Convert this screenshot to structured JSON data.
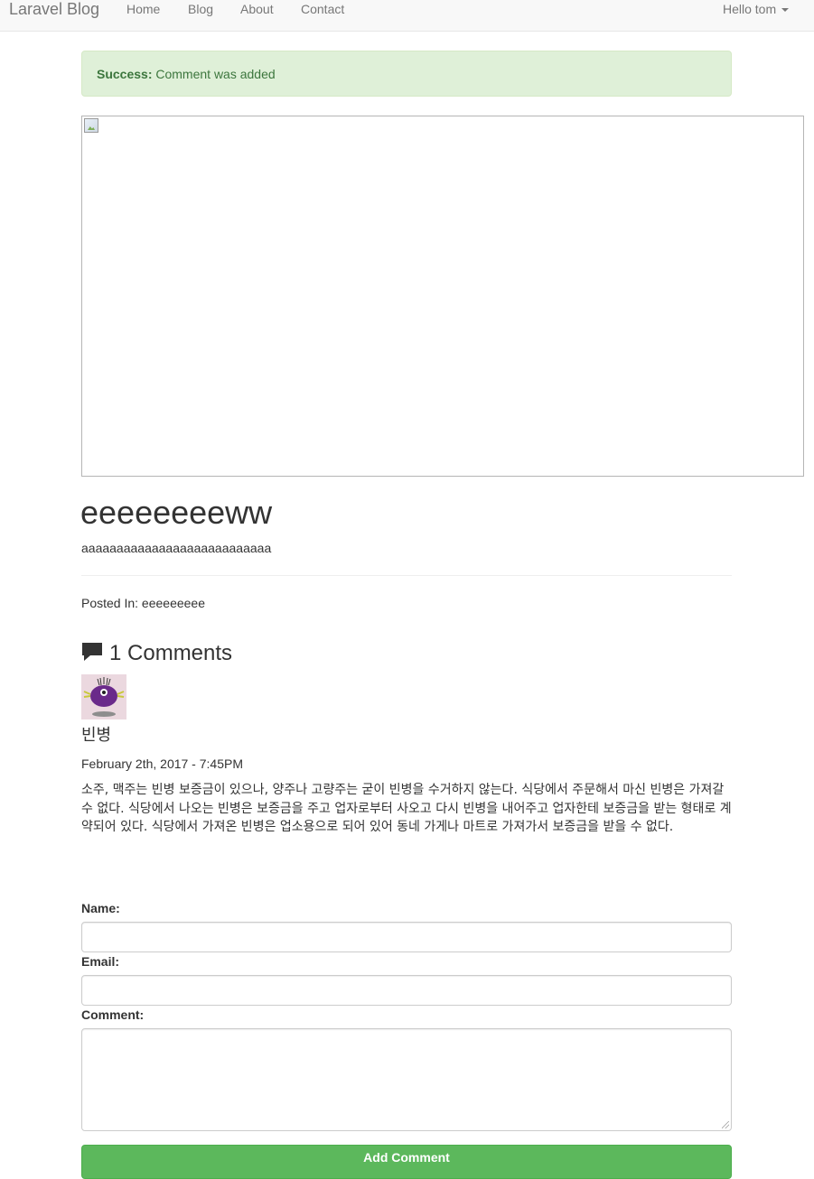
{
  "navbar": {
    "brand": "Laravel Blog",
    "links": [
      "Home",
      "Blog",
      "About",
      "Contact"
    ],
    "user_menu": "Hello tom"
  },
  "alert": {
    "title": "Success:",
    "message": "Comment was added",
    "color_bg": "#dff0d8",
    "color_text": "#3c763d"
  },
  "post": {
    "title": "eeeeeeeeww",
    "body": "aaaaaaaaaaaaaaaaaaaaaaaaaaa",
    "posted_in_label": "Posted In: eeeeeeeee"
  },
  "comments": {
    "heading": "1 Comments",
    "icon": "comment-icon",
    "items": [
      {
        "author": "빈병",
        "date": "February 2th, 2017 - 7:45PM",
        "text": "소주, 맥주는 빈병 보증금이 있으나, 양주나 고량주는 굳이 빈병을 수거하지 않는다. 식당에서 주문해서 마신 빈병은 가져갈수 없다. 식당에서 나오는 빈병은 보증금을 주고 업자로부터 사오고 다시 빈병을 내어주고 업자한테 보증금을 받는 형태로 계약되어 있다. 식당에서 가져온 빈병은 업소용으로 되어 있어 동네 가게나 마트로 가져가서 보증금을 받을 수 없다."
      }
    ]
  },
  "form": {
    "name_label": "Name:",
    "email_label": "Email:",
    "comment_label": "Comment:",
    "submit_label": "Add Comment",
    "submit_color": "#5cb85c"
  }
}
